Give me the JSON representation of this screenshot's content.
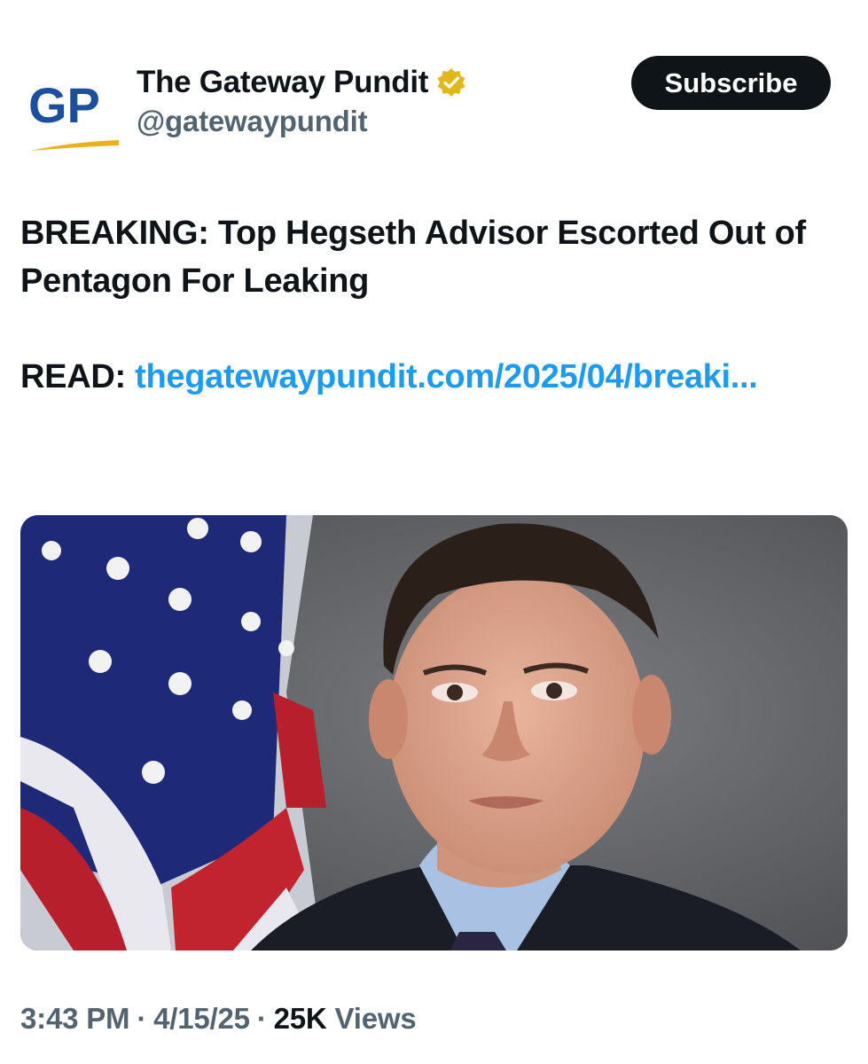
{
  "header": {
    "avatar_text": "GP",
    "display_name": "The Gateway Pundit",
    "handle": "@gatewaypundit",
    "verified_badge_color": "#e2b719",
    "subscribe_label": "Subscribe"
  },
  "tweet": {
    "headline": "BREAKING: Top Hegseth Advisor Escorted Out of Pentagon For Leaking",
    "read_prefix": "READ: ",
    "link_text": "thegatewaypundit.com/2025/04/breaki...",
    "link_color": "#1d9bf0"
  },
  "media": {
    "description_icon": "photo"
  },
  "meta": {
    "time": "3:43 PM",
    "date": "4/15/25",
    "views_count": "25K",
    "views_label": "Views",
    "separator": "·"
  }
}
